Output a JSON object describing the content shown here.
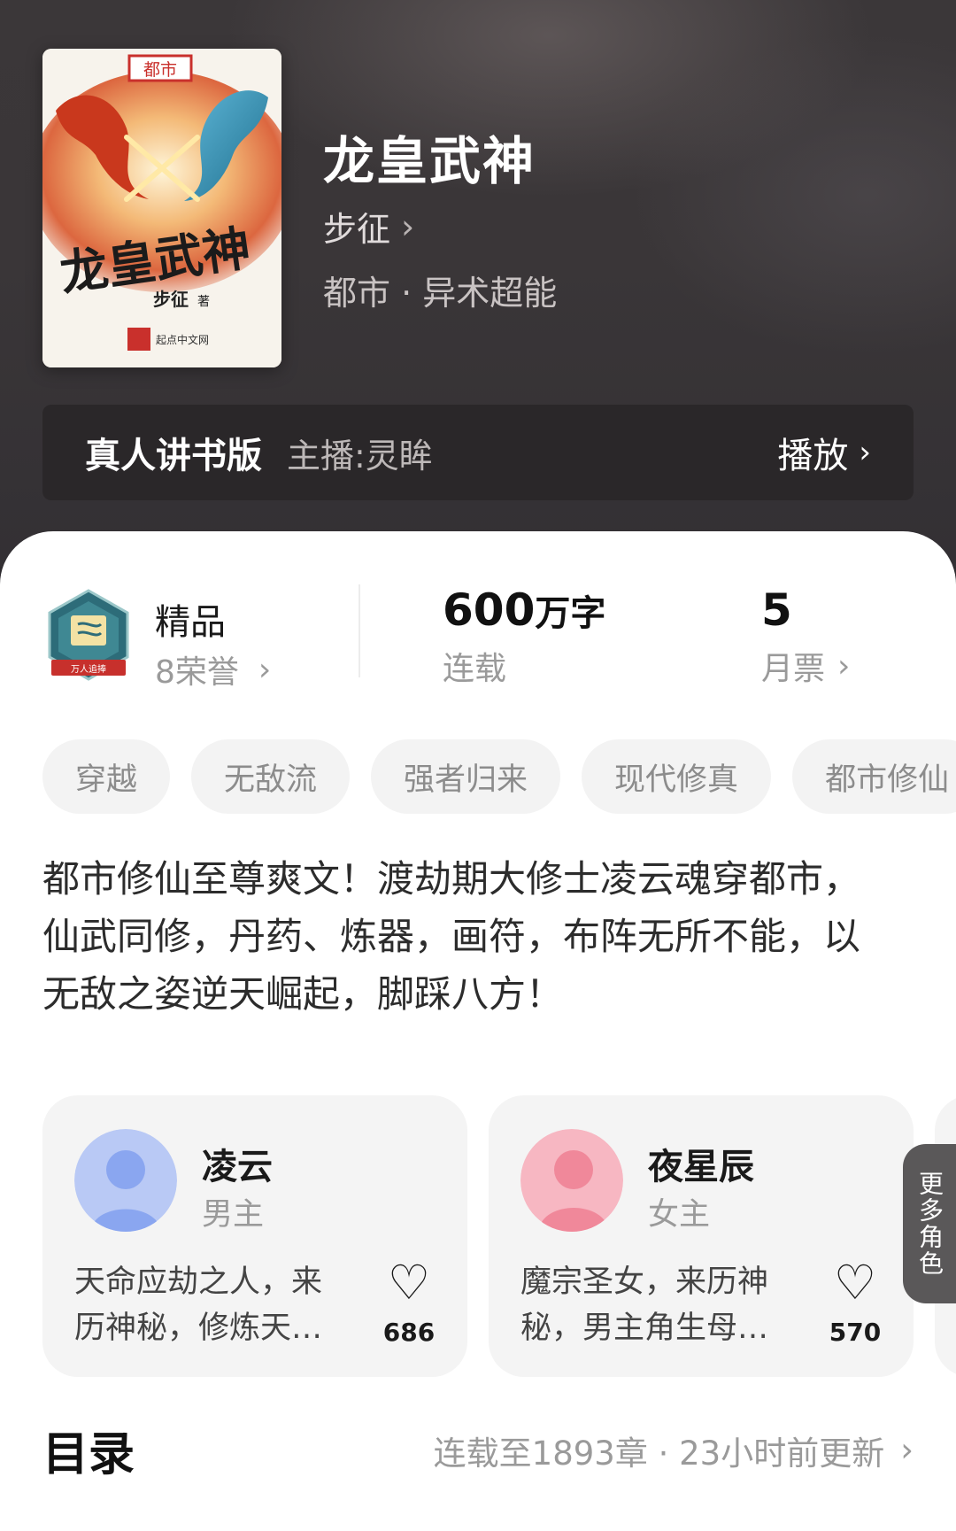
{
  "book": {
    "title": "龙皇武神",
    "author": "步征",
    "genre": "都市 · 异术超能",
    "cover": {
      "category_stamp": "都市",
      "title_art": "龙皇武神",
      "author_art": "步征",
      "author_suffix": "著",
      "publisher": "起点中文网"
    }
  },
  "audio": {
    "version_label": "真人讲书版",
    "host": "主播:灵眸",
    "play_label": "播放"
  },
  "stats": {
    "badge_ribbon": "万人追捧",
    "quality_label": "精品",
    "honors": "8荣誉",
    "word_count": "600",
    "word_unit": "万字",
    "status": "连载",
    "monthly_votes": "5",
    "monthly_votes_label": "月票"
  },
  "tags": [
    "穿越",
    "无敌流",
    "强者归来",
    "现代修真",
    "都市修仙"
  ],
  "synopsis": "都市修仙至尊爽文！渡劫期大修士凌云魂穿都市，仙武同修，丹药、炼器，画符，布阵无所不能，以无敌之姿逆天崛起，脚踩八方！",
  "roles": [
    {
      "name": "凌云",
      "type": "男主",
      "desc": "天命应劫之人，来历神秘，修炼天…",
      "likes": "686",
      "avatar_color": "#8aa6f0"
    },
    {
      "name": "夜星辰",
      "type": "女主",
      "desc": "魔宗圣女，来历神秘，男主角生母…",
      "likes": "570",
      "avatar_color": "#f0889a"
    }
  ],
  "more_roles_label": "更多角色",
  "toc": {
    "title": "目录",
    "status": "连载至1893章 · 23小时前更新"
  },
  "icons": {
    "chevron": "chevron-right-icon",
    "heart": "heart-outline-icon"
  }
}
